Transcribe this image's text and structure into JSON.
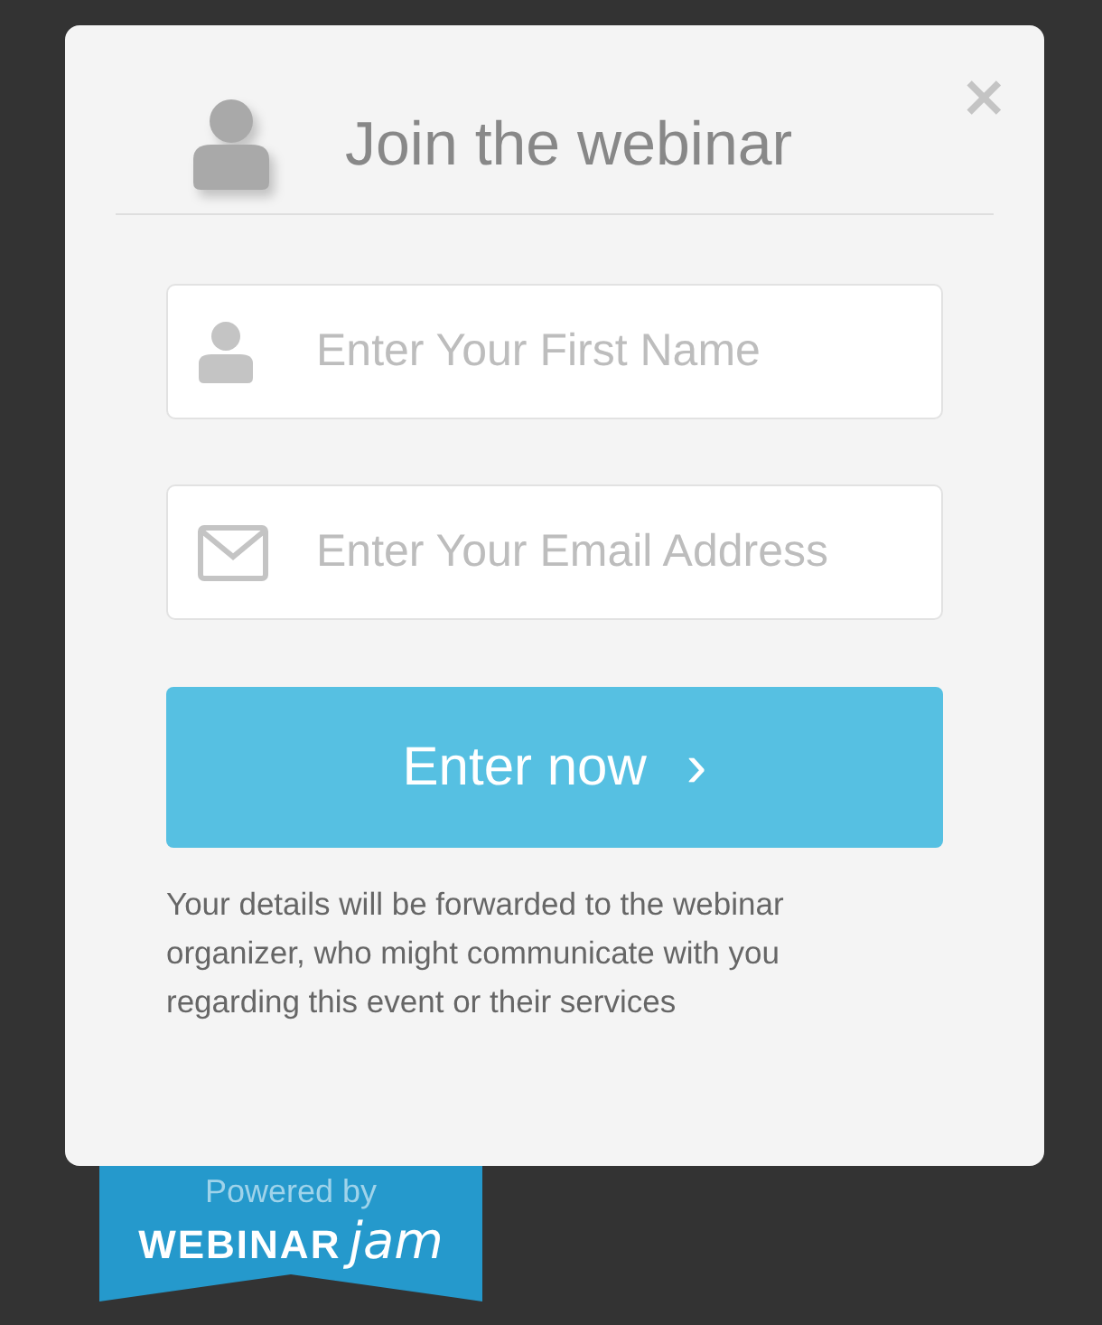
{
  "dialog": {
    "title": "Join the webinar",
    "close": "×"
  },
  "fields": [
    {
      "kind": "person",
      "placeholder": "Enter Your First Name"
    },
    {
      "kind": "email",
      "placeholder": "Enter Your Email Address"
    }
  ],
  "submit_button": {
    "label": "Enter now",
    "caret": "›"
  },
  "disclaimer": "Your details will be forwarded to the webinar organizer, who might communicate with you regarding this event or their services",
  "badge": {
    "caption": "Powered by",
    "brand": "WEBINAR",
    "brand_suffix": "jam"
  }
}
